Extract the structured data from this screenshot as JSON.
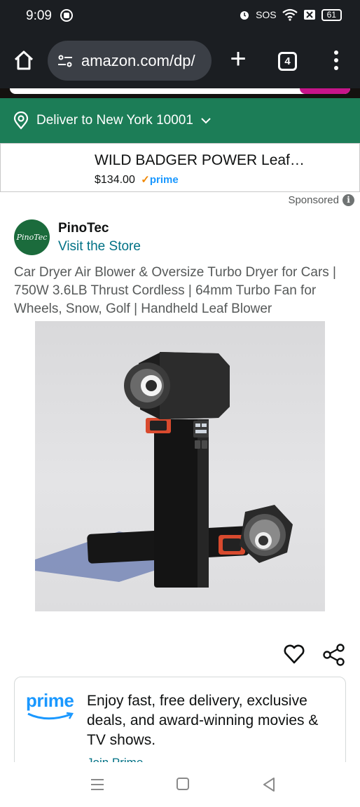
{
  "status_bar": {
    "time": "9:09",
    "sos": "SOS",
    "battery": "61"
  },
  "browser": {
    "url": "amazon.com/dp/",
    "tab_count": "4"
  },
  "delivery": {
    "label": "Deliver to New York 10001"
  },
  "sticky_product": {
    "title": "WILD BADGER POWER Leaf…",
    "price": "$134.00",
    "prime_label": "prime"
  },
  "sponsored_label": "Sponsored",
  "store": {
    "logo_text": "PinoTec",
    "name": "PinoTec",
    "link": "Visit the Store"
  },
  "product": {
    "title": "Car Dryer Air Blower & Oversize Turbo Dryer for Cars | 750W 3.6LB Thrust Cordless | 64mm Turbo Fan for Wheels, Snow, Golf | Handheld Leaf Blower"
  },
  "prime_promo": {
    "logo": "prime",
    "text": "Enjoy fast, free delivery, exclusive deals, and award-winning movies & TV shows.",
    "link": "Join Prime"
  },
  "colors": {
    "delivery_bar": "#1c7d57",
    "link": "#007185",
    "prime_blue": "#1a98ff",
    "browser_chrome": "#1b1e22"
  },
  "icons": [
    "home-icon",
    "site-settings-icon",
    "plus-icon",
    "tabs-icon",
    "more-vert-icon",
    "location-pin-icon",
    "chevron-down-icon",
    "info-icon",
    "heart-icon",
    "share-icon",
    "menu-icon",
    "square-icon",
    "back-triangle-icon"
  ]
}
